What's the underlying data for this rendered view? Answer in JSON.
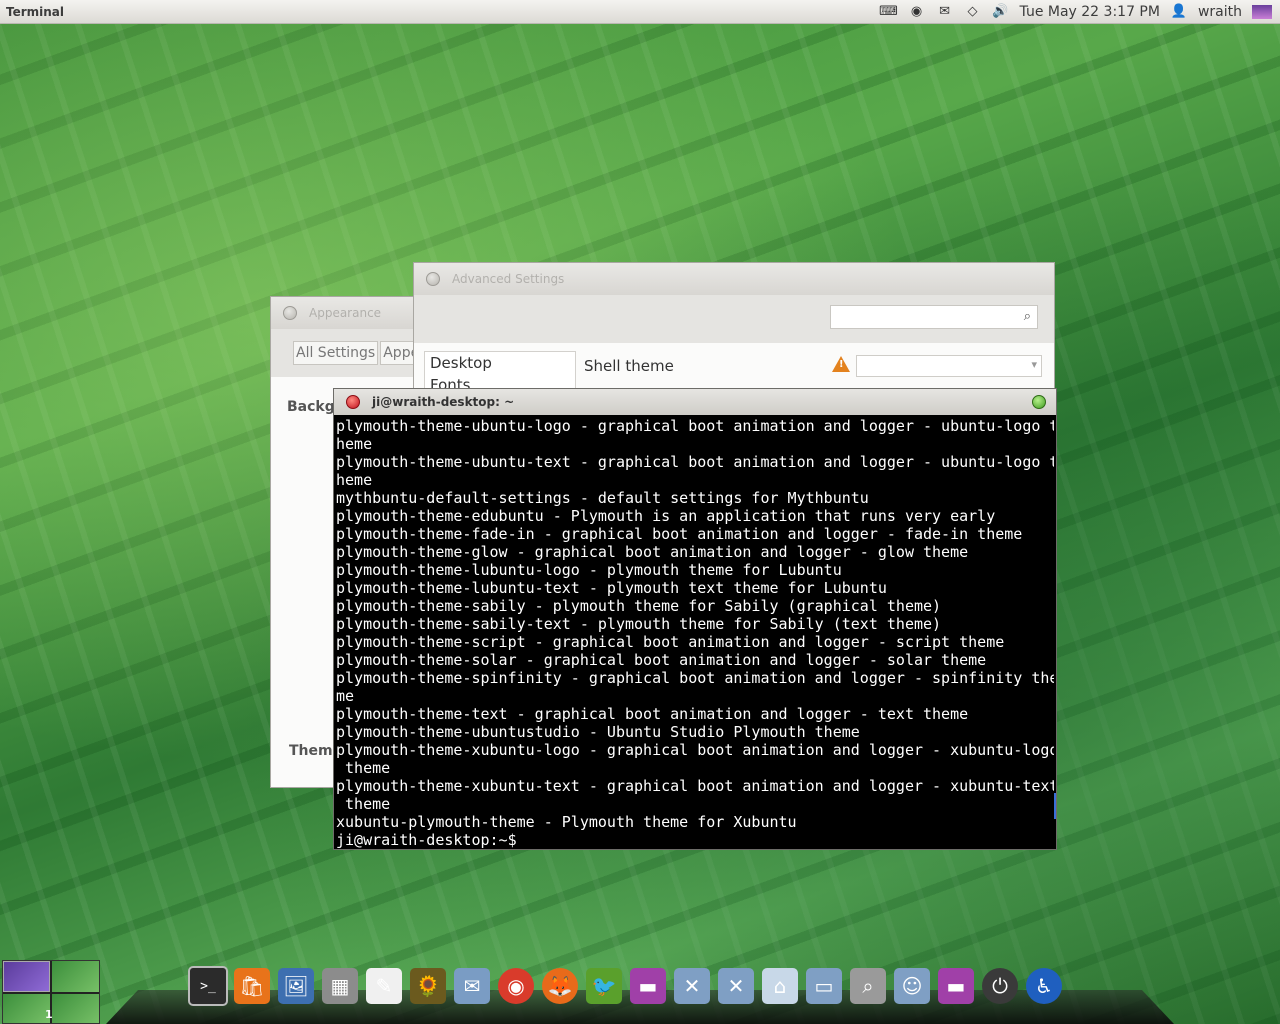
{
  "top_panel": {
    "app_name": "Terminal",
    "clock": "Tue May 22  3:17 PM",
    "user": "wraith",
    "tray_icons": [
      "keyboard-icon",
      "chrome-status-icon",
      "mail-icon",
      "wifi-icon",
      "volume-icon",
      "user-icon",
      "session-icon"
    ]
  },
  "appearance": {
    "title": "Appearance",
    "tabs": [
      "All Settings",
      "Appe"
    ],
    "background_label": "Backgr",
    "theme_label": "Them"
  },
  "advanced_settings": {
    "title": "Advanced Settings",
    "search_placeholder": "",
    "categories": [
      "Desktop",
      "Fonts"
    ],
    "shell_theme_label": "Shell theme",
    "warning_symbol": "!"
  },
  "terminal": {
    "title": "ji@wraith-desktop: ~",
    "lines": [
      "plymouth-theme-ubuntu-logo - graphical boot animation and logger - ubuntu-logo t",
      "heme",
      "plymouth-theme-ubuntu-text - graphical boot animation and logger - ubuntu-logo t",
      "heme",
      "mythbuntu-default-settings - default settings for Mythbuntu",
      "plymouth-theme-edubuntu - Plymouth is an application that runs very early",
      "plymouth-theme-fade-in - graphical boot animation and logger - fade-in theme",
      "plymouth-theme-glow - graphical boot animation and logger - glow theme",
      "plymouth-theme-lubuntu-logo - plymouth theme for Lubuntu",
      "plymouth-theme-lubuntu-text - plymouth text theme for Lubuntu",
      "plymouth-theme-sabily - plymouth theme for Sabily (graphical theme)",
      "plymouth-theme-sabily-text - plymouth theme for Sabily (text theme)",
      "plymouth-theme-script - graphical boot animation and logger - script theme",
      "plymouth-theme-solar - graphical boot animation and logger - solar theme",
      "plymouth-theme-spinfinity - graphical boot animation and logger - spinfinity the",
      "me",
      "plymouth-theme-text - graphical boot animation and logger - text theme",
      "plymouth-theme-ubuntustudio - Ubuntu Studio Plymouth theme",
      "plymouth-theme-xubuntu-logo - graphical boot animation and logger - xubuntu-logo",
      " theme",
      "plymouth-theme-xubuntu-text - graphical boot animation and logger - xubuntu-text",
      " theme",
      "xubuntu-plymouth-theme - Plymouth theme for Xubuntu",
      "ji@wraith-desktop:~$ "
    ]
  },
  "workspace": {
    "number": "1"
  },
  "dock": {
    "icons": [
      {
        "name": "terminal-icon",
        "glyph": ">_",
        "color": "#2b2b2b"
      },
      {
        "name": "software-center-icon",
        "glyph": "🛍",
        "color": "#e8731a"
      },
      {
        "name": "screenshot-icon",
        "glyph": "🖼",
        "color": "#3d6fb0"
      },
      {
        "name": "calculator-icon",
        "glyph": "▦",
        "color": "#8c8c8c"
      },
      {
        "name": "text-editor-icon",
        "glyph": "✎",
        "color": "#f0f0f0"
      },
      {
        "name": "photo-viewer-icon",
        "glyph": "🌻",
        "color": "#6b5a1e"
      },
      {
        "name": "mail-client-icon",
        "glyph": "✉",
        "color": "#7a9cc4"
      },
      {
        "name": "chrome-icon",
        "glyph": "◉",
        "color": "#d93b2b"
      },
      {
        "name": "firefox-icon",
        "glyph": "🦊",
        "color": "#e86a1a"
      },
      {
        "name": "pidgin-icon",
        "glyph": "🐦",
        "color": "#5aa02c"
      },
      {
        "name": "system-monitor-icon",
        "glyph": "▬",
        "color": "#a040a8"
      },
      {
        "name": "tools-folder-icon",
        "glyph": "✕",
        "color": "#7f9fc4"
      },
      {
        "name": "settings-folder-icon",
        "glyph": "✕",
        "color": "#7f9fc4"
      },
      {
        "name": "home-folder-icon",
        "glyph": "⌂",
        "color": "#c8d8e8"
      },
      {
        "name": "documents-folder-icon",
        "glyph": "▭",
        "color": "#7f9fc4"
      },
      {
        "name": "search-tool-icon",
        "glyph": "⌕",
        "color": "#9a9a9a"
      },
      {
        "name": "user-folder-icon",
        "glyph": "☺",
        "color": "#7f9fc4"
      },
      {
        "name": "display-settings-icon",
        "glyph": "▬",
        "color": "#a040a8"
      },
      {
        "name": "power-icon",
        "glyph": "⏻",
        "color": "#3a3a3a"
      },
      {
        "name": "accessibility-icon",
        "glyph": "♿",
        "color": "#1f5fbf"
      }
    ]
  }
}
